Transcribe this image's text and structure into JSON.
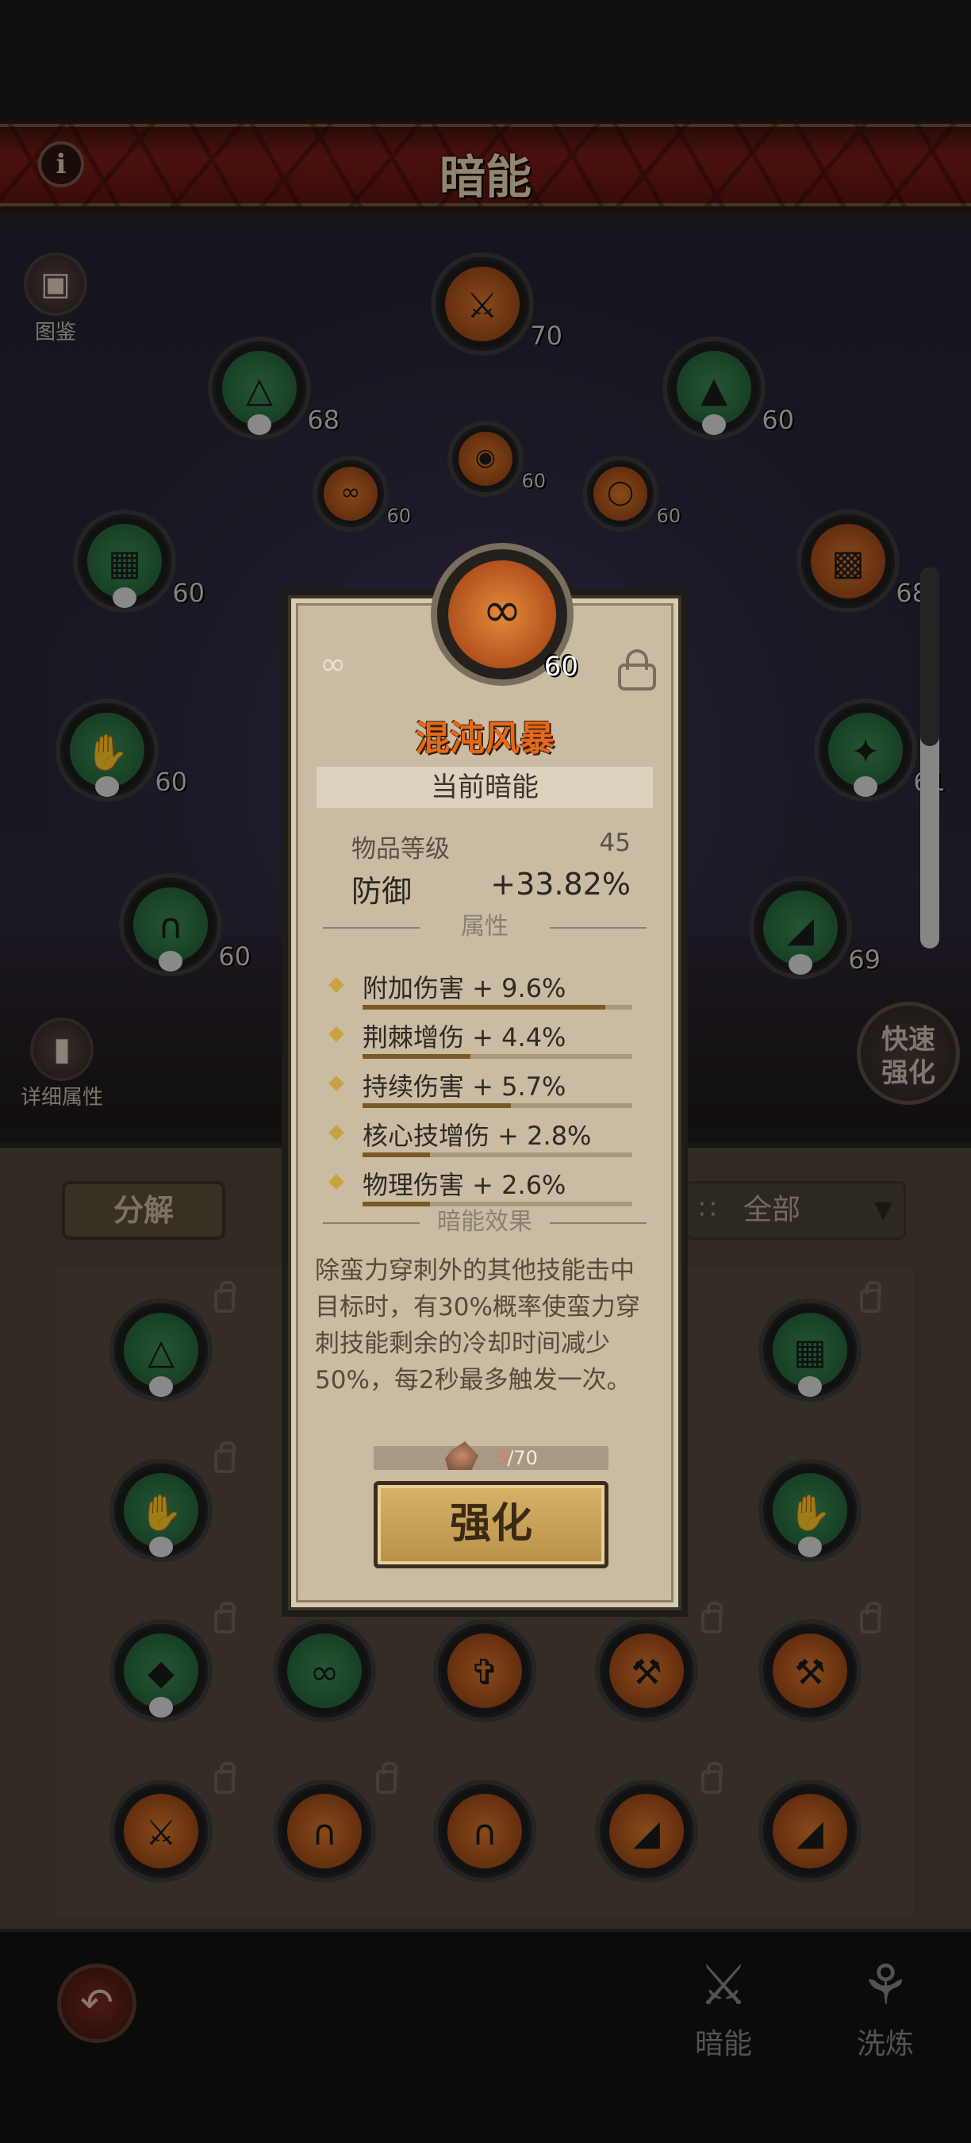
{
  "header": {
    "title": "暗能",
    "info_icon": "i"
  },
  "side": {
    "codex_label": "图鉴",
    "detail_label": "详细属性"
  },
  "quick_upgrade": {
    "label_line1": "快速",
    "label_line2": "强化"
  },
  "slots": [
    {
      "level": "70",
      "color": "orange"
    },
    {
      "level": "68",
      "color": "green"
    },
    {
      "level": "60",
      "color": "green"
    },
    {
      "level": "60",
      "color": "orange"
    },
    {
      "level": "60",
      "color": "orange"
    },
    {
      "level": "60",
      "color": "orange"
    },
    {
      "level": "60",
      "color": "green"
    },
    {
      "level": "68",
      "color": "orange"
    },
    {
      "level": "60",
      "color": "green"
    },
    {
      "level": "61",
      "color": "green"
    },
    {
      "level": "60",
      "color": "green"
    },
    {
      "level": "69",
      "color": "green"
    }
  ],
  "inventory": {
    "decompose_label": "分解",
    "filter_label": "全部"
  },
  "bottom_nav": {
    "items": [
      {
        "label": "暗能"
      },
      {
        "label": "洗炼"
      }
    ]
  },
  "card": {
    "item_level_badge": "60",
    "item_name": "混沌风暴",
    "subtitle": "当前暗能",
    "item_level_label": "物品等级",
    "item_level_value": "45",
    "main_stat_label": "防御",
    "main_stat_value": "+33.82%",
    "attributes_header": "属性",
    "affixes": [
      {
        "text": "附加伤害 + 9.6%",
        "progress": 0.9
      },
      {
        "text": "荆棘增伤 + 4.4%",
        "progress": 0.4
      },
      {
        "text": "持续伤害 + 5.7%",
        "progress": 0.55
      },
      {
        "text": "核心技增伤 + 2.8%",
        "progress": 0.25
      },
      {
        "text": "物理伤害 + 2.6%",
        "progress": 0.25
      }
    ],
    "effect_header": "暗能效果",
    "effect_text": "除蛮力穿刺外的其他技能击中目标时，有30%概率使蛮力穿刺技能剩余的冷却时间减少50%，每2秒最多触发一次。",
    "material_have": "3",
    "material_need": "/70",
    "upgrade_label": "强化"
  }
}
